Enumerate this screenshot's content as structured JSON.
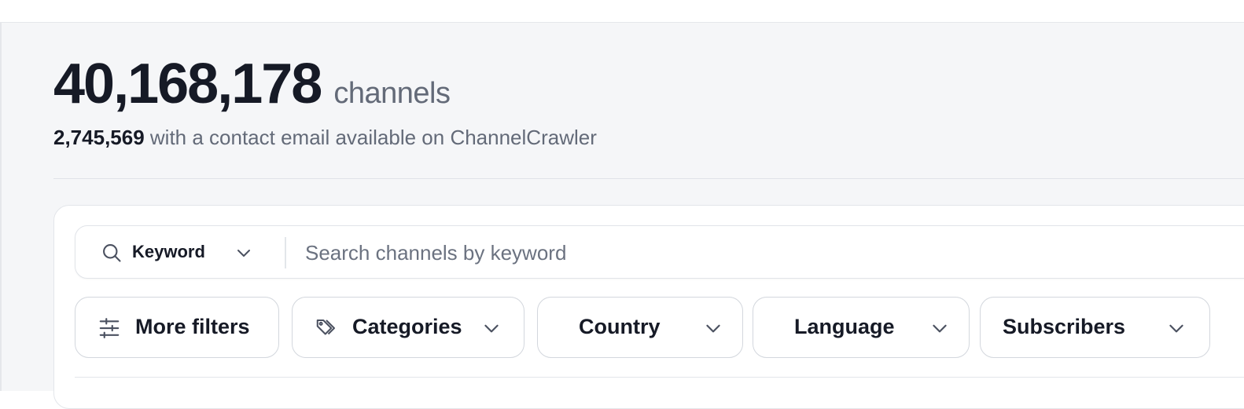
{
  "header": {
    "channel_count": "40,168,178",
    "channel_unit": "channels",
    "email_count": "2,745,569",
    "email_text": " with a contact email available on ChannelCrawler"
  },
  "search": {
    "mode_label": "Keyword",
    "placeholder": "Search channels by keyword",
    "value": ""
  },
  "filters": {
    "more_filters": "More filters",
    "categories": "Categories",
    "country": "Country",
    "language": "Language",
    "subscribers": "Subscribers"
  },
  "icons": {
    "search": "search-icon",
    "chevron": "chevron-down-icon",
    "sliders": "sliders-icon",
    "tags": "tags-icon"
  },
  "colors": {
    "text_dark": "#161a26",
    "text_muted": "#636a78",
    "background": "#f5f6f8",
    "border": "#d3d7dd"
  }
}
